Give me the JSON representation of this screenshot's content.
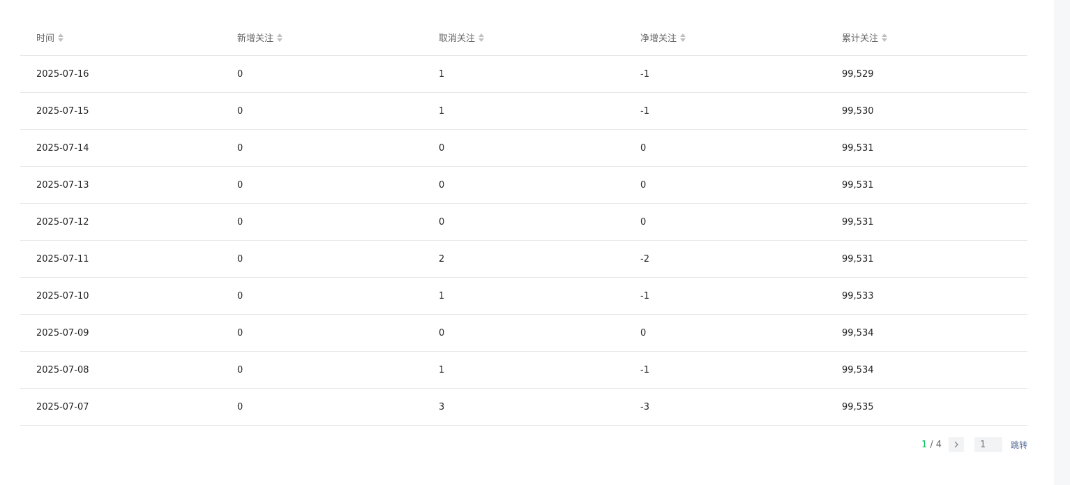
{
  "table": {
    "headers": [
      "时间",
      "新增关注",
      "取消关注",
      "净增关注",
      "累计关注"
    ],
    "rows": [
      [
        "2025-07-16",
        "0",
        "1",
        "-1",
        "99,529"
      ],
      [
        "2025-07-15",
        "0",
        "1",
        "-1",
        "99,530"
      ],
      [
        "2025-07-14",
        "0",
        "0",
        "0",
        "99,531"
      ],
      [
        "2025-07-13",
        "0",
        "0",
        "0",
        "99,531"
      ],
      [
        "2025-07-12",
        "0",
        "0",
        "0",
        "99,531"
      ],
      [
        "2025-07-11",
        "0",
        "2",
        "-2",
        "99,531"
      ],
      [
        "2025-07-10",
        "0",
        "1",
        "-1",
        "99,533"
      ],
      [
        "2025-07-09",
        "0",
        "0",
        "0",
        "99,534"
      ],
      [
        "2025-07-08",
        "0",
        "1",
        "-1",
        "99,534"
      ],
      [
        "2025-07-07",
        "0",
        "3",
        "-3",
        "99,535"
      ]
    ]
  },
  "pagination": {
    "current": "1",
    "separator": "/",
    "total": "4",
    "input_placeholder": "1",
    "jump_label": "跳转"
  },
  "icons": {
    "sort": "sort-icon",
    "next": "chevron-right-icon"
  },
  "colors": {
    "accent": "#07c160",
    "link": "#576b95"
  }
}
